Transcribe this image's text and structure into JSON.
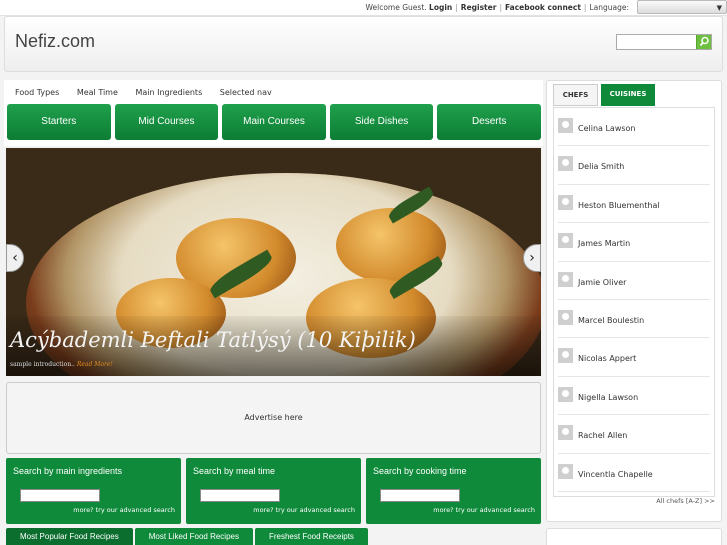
{
  "topbar": {
    "welcome": "Welcome Guest.",
    "login": "Login",
    "register": "Register",
    "facebook": "Facebook connect",
    "language": "Language:"
  },
  "header": {
    "logo": "Nefiz.com",
    "search_placeholder": ""
  },
  "nav": {
    "items": [
      "Food Types",
      "Meal Time",
      "Main Ingredients",
      "Selected nav"
    ]
  },
  "categories": [
    "Starters",
    "Mid Courses",
    "Main Courses",
    "Side Dishes",
    "Deserts"
  ],
  "hero": {
    "title": "Acýbademli Þeftali Tatlýsý (10 Kiþilik)",
    "intro": "sample introduction..",
    "read_more": "Read More!"
  },
  "advert": "Advertise here",
  "search_boxes": [
    {
      "label": "Search by main ingredients",
      "more": "more? try our advanced search"
    },
    {
      "label": "Search by meal time",
      "more": "more? try our advanced search"
    },
    {
      "label": "Search by cooking time",
      "more": "more? try our advanced search"
    }
  ],
  "bottom_tabs": [
    "Most Popular Food Recipes",
    "Most Liked Food Recipes",
    "Freshest Food Receipts"
  ],
  "sidebar": {
    "tabs": [
      "CHEFS",
      "CUISINES"
    ],
    "chefs": [
      "Celina Lawson",
      "Delia Smith",
      "Heston Bluementhal",
      "James Martin",
      "Jamie Oliver",
      "Marcel Boulestin",
      "Nicolas Appert",
      "Nigella Lawson",
      "Rachel Allen",
      "Vincentla Chapelle"
    ],
    "all_chefs": "All chefs [A-Z] >>"
  },
  "colors": {
    "brand_green": "#0f8a3a"
  }
}
